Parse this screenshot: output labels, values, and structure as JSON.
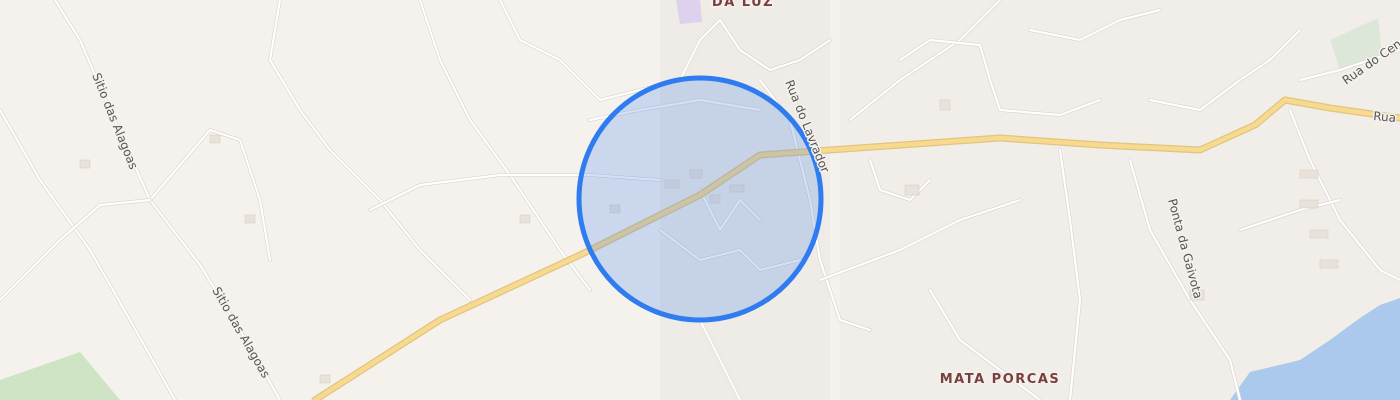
{
  "map": {
    "places": {
      "da_luz": "DA LUZ",
      "mata_porcas": "MATA PORCAS"
    },
    "streets": {
      "sitio_alagoas_1": "Sitio das Alagoas",
      "sitio_alagoas_2": "Sitio das Alagoas",
      "rua_lavrador": "Rua do Lavrador",
      "ponta_gaivota": "Ponta da Gaivota",
      "rua_centro": "Rua do Cen",
      "rua_right": "Rua"
    },
    "colors": {
      "background": "#f5f2ee",
      "main_road": "#f7d98f",
      "water": "#aac9ec",
      "park": "#cfe4c4",
      "radius_fill": "#4a86e8",
      "radius_stroke": "#2f7bf0"
    },
    "radius_circle": "search-radius"
  }
}
